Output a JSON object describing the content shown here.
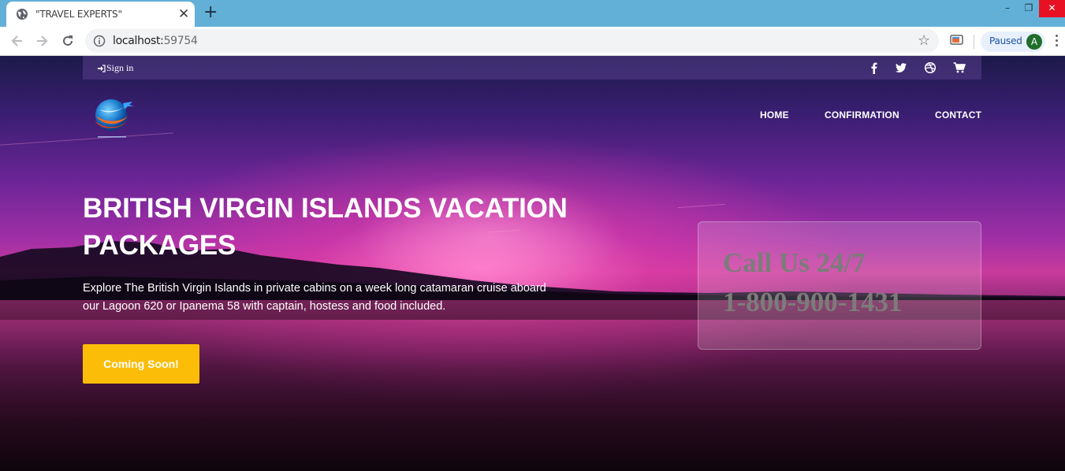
{
  "browser": {
    "tab_title": "\"TRAVEL EXPERTS\"",
    "tab_close": "✕",
    "new_tab": "+",
    "url_host": "localhost:",
    "url_port": "59754",
    "profile_status": "Paused",
    "profile_initial": "A",
    "icons": [
      "globe-icon",
      "back-icon",
      "forward-icon",
      "reload-icon",
      "info-icon",
      "star-icon",
      "cast-icon",
      "menu-icon"
    ],
    "window_controls": {
      "minimize": "–",
      "maximize": "❐",
      "close": "✕"
    }
  },
  "page": {
    "topbar": {
      "signin_label": "Sign in",
      "social_icons": [
        "facebook-icon",
        "twitter-icon",
        "dribbble-icon",
        "cart-icon"
      ]
    },
    "nav": {
      "items": [
        "HOME",
        "CONFIRMATION",
        "CONTACT"
      ]
    },
    "hero": {
      "title": "BRITISH VIRGIN ISLANDS VACATION PACKAGES",
      "description": "Explore The British Virgin Islands in private cabins on a week long catamaran cruise aboard our Lagoon 620 or Ipanema 58 with captain, hostess and food included.",
      "cta_label": "Coming Soon!"
    },
    "call_box": {
      "line1": "Call Us 24/7",
      "line2": "1-800-900-1431"
    },
    "colors": {
      "cta": "#fbbd08",
      "tabbar": "#62b0d7",
      "window_close": "#e81123",
      "profile_avatar": "#1f6e2a"
    }
  }
}
